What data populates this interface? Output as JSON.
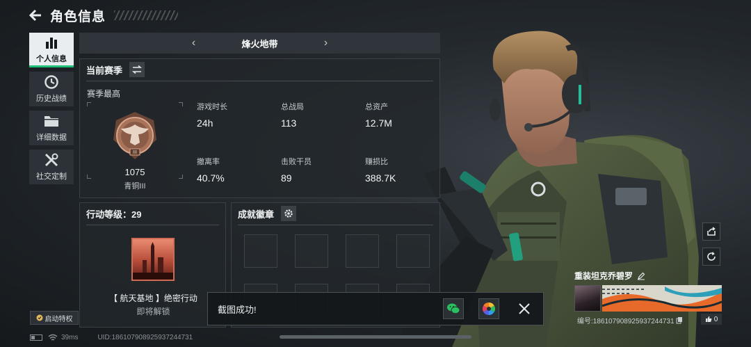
{
  "header": {
    "title": "角色信息"
  },
  "sidebar": {
    "items": [
      {
        "label": "个人信息",
        "icon": "bar-chart-icon",
        "active": true
      },
      {
        "label": "历史战绩",
        "icon": "history-clock-icon",
        "active": false
      },
      {
        "label": "详细数据",
        "icon": "folder-icon",
        "active": false
      },
      {
        "label": "社交定制",
        "icon": "tools-icon",
        "active": false
      }
    ]
  },
  "map_selector": {
    "name": "烽火地带",
    "prev": "‹",
    "next": "›"
  },
  "season": {
    "title": "当前赛季",
    "subtitle": "赛季最高",
    "rank": {
      "score": "1075",
      "name": "青铜III"
    },
    "stats": [
      {
        "label": "游戏时长",
        "value": "24h"
      },
      {
        "label": "总战局",
        "value": "113"
      },
      {
        "label": "总资产",
        "value": "12.7M"
      },
      {
        "label": "撤离率",
        "value": "40.7%"
      },
      {
        "label": "击败干员",
        "value": "89"
      },
      {
        "label": "赚损比",
        "value": "388.7K"
      }
    ]
  },
  "action_level": {
    "title": "行动等级：29",
    "mission_title": "【 航天基地 】绝密行动",
    "mission_status": "即将解锁"
  },
  "badges": {
    "title": "成就徽章"
  },
  "perk_button": {
    "label": "启动特权"
  },
  "status_bar": {
    "ping": "39ms",
    "uid": "UID:186107908925937244731"
  },
  "operator": {
    "name": "重装坦克乔碧罗",
    "card_id": "编号:186107908925937244731",
    "likes": "0"
  },
  "toast": {
    "text": "截图成功!"
  },
  "colors": {
    "accent_green": "#1fbf7a",
    "rank_bronze": "#a9735a",
    "panel_bg": "#22272b"
  }
}
